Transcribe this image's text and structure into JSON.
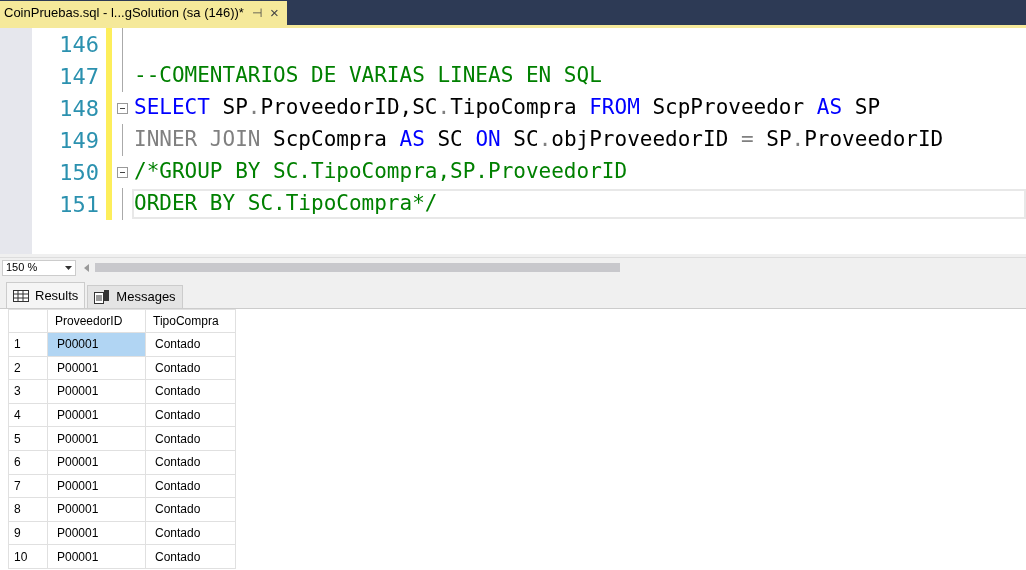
{
  "tab": {
    "title": "CoinPruebas.sql - l...gSolution (sa (146))*",
    "pin": "⊣",
    "close": "×"
  },
  "editor": {
    "lines": [
      {
        "number": "146",
        "foldable": false,
        "current": false
      },
      {
        "number": "147",
        "foldable": false,
        "current": false,
        "tokens": [
          {
            "kind": "comment",
            "text": "--COMENTARIOS DE VARIAS LINEAS EN SQL"
          }
        ]
      },
      {
        "number": "148",
        "foldable": true,
        "current": false,
        "tokens": [
          {
            "kind": "keyword",
            "text": "SELECT"
          },
          {
            "kind": "plain",
            "text": " SP"
          },
          {
            "kind": "gray",
            "text": "."
          },
          {
            "kind": "plain",
            "text": "ProveedorID,SC"
          },
          {
            "kind": "gray",
            "text": "."
          },
          {
            "kind": "plain",
            "text": "TipoCompra "
          },
          {
            "kind": "keyword",
            "text": "FROM"
          },
          {
            "kind": "plain",
            "text": " ScpProveedor "
          },
          {
            "kind": "keyword",
            "text": "AS"
          },
          {
            "kind": "plain",
            "text": " SP"
          }
        ]
      },
      {
        "number": "149",
        "foldable": false,
        "current": false,
        "tokens": [
          {
            "kind": "gray",
            "text": "INNER JOIN"
          },
          {
            "kind": "plain",
            "text": " ScpCompra "
          },
          {
            "kind": "keyword",
            "text": "AS"
          },
          {
            "kind": "plain",
            "text": " SC "
          },
          {
            "kind": "keyword",
            "text": "ON"
          },
          {
            "kind": "plain",
            "text": " SC"
          },
          {
            "kind": "gray",
            "text": "."
          },
          {
            "kind": "plain",
            "text": "objProveedorID "
          },
          {
            "kind": "gray",
            "text": "="
          },
          {
            "kind": "plain",
            "text": " SP"
          },
          {
            "kind": "gray",
            "text": "."
          },
          {
            "kind": "plain",
            "text": "ProveedorID"
          }
        ]
      },
      {
        "number": "150",
        "foldable": true,
        "current": false,
        "tokens": [
          {
            "kind": "comment",
            "text": "/*GROUP BY SC.TipoCompra,SP.ProveedorID"
          }
        ]
      },
      {
        "number": "151",
        "foldable": false,
        "current": true,
        "tokens": [
          {
            "kind": "comment",
            "text": "ORDER BY SC.TipoCompra*/"
          }
        ]
      }
    ]
  },
  "zoom": "150 %",
  "result_tabs": [
    {
      "label": "Results",
      "selected": true
    },
    {
      "label": "Messages",
      "selected": false
    }
  ],
  "table": {
    "columns": [
      "ProveedorID",
      "TipoCompra"
    ],
    "rows": [
      {
        "number": "1",
        "cells": [
          "P00001",
          "Contado"
        ],
        "selected": true
      },
      {
        "number": "2",
        "cells": [
          "P00001",
          "Contado"
        ],
        "selected": false
      },
      {
        "number": "3",
        "cells": [
          "P00001",
          "Contado"
        ],
        "selected": false
      },
      {
        "number": "4",
        "cells": [
          "P00001",
          "Contado"
        ],
        "selected": false
      },
      {
        "number": "5",
        "cells": [
          "P00001",
          "Contado"
        ],
        "selected": false
      },
      {
        "number": "6",
        "cells": [
          "P00001",
          "Contado"
        ],
        "selected": false
      },
      {
        "number": "7",
        "cells": [
          "P00001",
          "Contado"
        ],
        "selected": false
      },
      {
        "number": "8",
        "cells": [
          "P00001",
          "Contado"
        ],
        "selected": false
      },
      {
        "number": "9",
        "cells": [
          "P00001",
          "Contado"
        ],
        "selected": false
      },
      {
        "number": "10",
        "cells": [
          "P00001",
          "Contado"
        ],
        "selected": false
      }
    ]
  }
}
